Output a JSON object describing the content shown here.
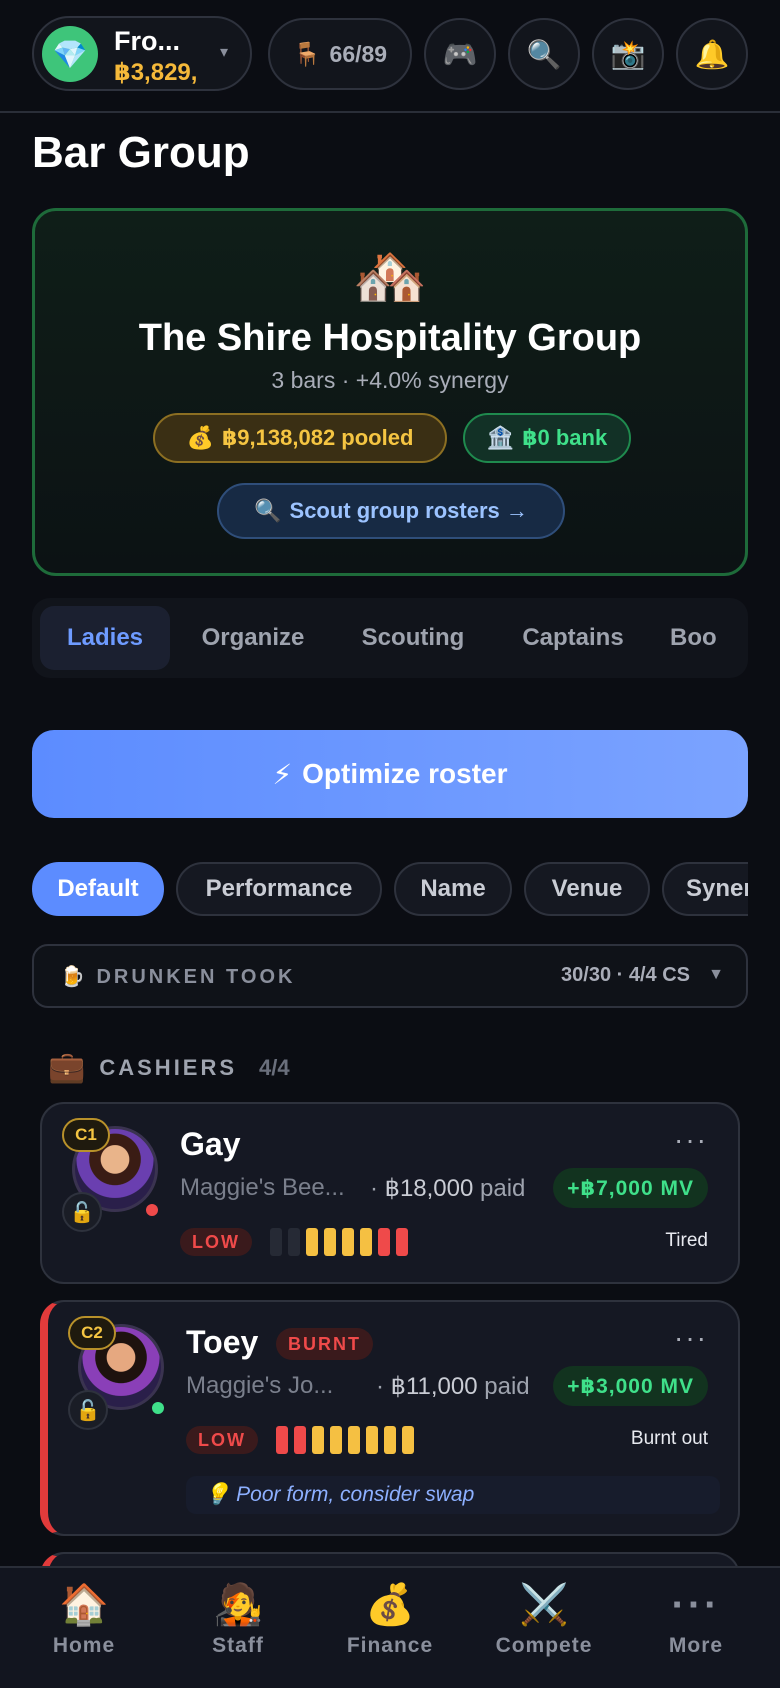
{
  "topbar": {
    "profile_icon": "gem-icon",
    "profile_name": "Fro...",
    "profile_money": "฿3,829,",
    "seats_icon": "chair-icon",
    "seats": "66/89",
    "icons": [
      "gamepad-icon",
      "search-icon",
      "camera-icon",
      "bell-icon"
    ]
  },
  "page": {
    "title": "Bar Group"
  },
  "group": {
    "icon": "houses-icon",
    "name": "The Shire Hospitality Group",
    "subtitle": "3 bars · +4.0% synergy",
    "pooled": "฿9,138,082 pooled",
    "bank": "฿0 bank",
    "scout_label": "Scout group rosters →"
  },
  "tabs": [
    "Ladies",
    "Organize",
    "Scouting",
    "Captains",
    "Boo"
  ],
  "active_tab": "Ladies",
  "optimize_label": "Optimize roster",
  "sorts": [
    "Default",
    "Performance",
    "Name",
    "Venue",
    "Syner"
  ],
  "active_sort": "Default",
  "venue": {
    "name": "DRUNKEN TOOK",
    "stats": "30/30 · 4/4 CS"
  },
  "section": {
    "label": "CASHIERS",
    "count": "4/4"
  },
  "ladies": [
    {
      "badge": "C1",
      "name": "Gay",
      "bar": "Maggie's Bee...",
      "paid_amount": "฿18,000",
      "paid_suffix": "paid",
      "mv": "+฿7,000 MV",
      "form": "LOW",
      "status": "Tired",
      "online_color": "#ef4a4a",
      "energy": [
        "empty",
        "empty",
        "y",
        "y",
        "y",
        "y",
        "r",
        "r"
      ]
    },
    {
      "badge": "C2",
      "name": "Toey",
      "tag": "BURNT",
      "bar": "Maggie's Jo...",
      "paid_amount": "฿11,000",
      "paid_suffix": "paid",
      "mv": "+฿3,000 MV",
      "form": "LOW",
      "status": "Burnt out",
      "online_color": "#3fe08a",
      "energy": [
        "r",
        "r",
        "y",
        "y",
        "y",
        "y",
        "y",
        "y"
      ],
      "tip": "Poor form, consider swap"
    }
  ],
  "nav": [
    {
      "label": "Home",
      "icon": "home-icon"
    },
    {
      "label": "Staff",
      "icon": "staff-icon"
    },
    {
      "label": "Finance",
      "icon": "money-bag-icon"
    },
    {
      "label": "Compete",
      "icon": "swords-icon"
    },
    {
      "label": "More",
      "icon": "more-icon"
    }
  ],
  "colors": {
    "accent": "#5c8cff",
    "gold": "#f5c542",
    "green": "#3fe08a",
    "red": "#ef4a4a"
  }
}
